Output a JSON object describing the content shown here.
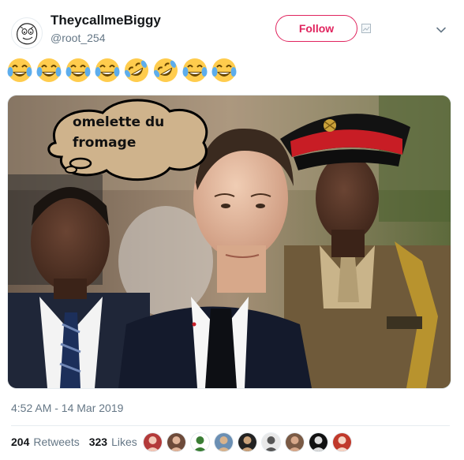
{
  "tweet": {
    "display_name": "TheycallmeBiggy",
    "handle": "@root_254",
    "follow_label": "Follow",
    "text_emojis": [
      "face-with-tears-of-joy",
      "face-with-tears-of-joy",
      "face-with-tears-of-joy",
      "face-with-tears-of-joy",
      "rolling-on-floor-laughing",
      "rolling-on-floor-laughing",
      "face-with-tears-of-joy",
      "face-with-tears-of-joy"
    ],
    "image_caption": "omelette du\nfromage",
    "timestamp": "4:52 AM - 14 Mar 2019",
    "retweets_count": "204",
    "retweets_label": "Retweets",
    "likes_count": "323",
    "likes_label": "Likes",
    "liker_avatar_count": 9
  },
  "colors": {
    "follow_accent": "#e0245e",
    "secondary_text": "#657786",
    "primary_text": "#14171a",
    "divider": "#e6ecf0"
  }
}
